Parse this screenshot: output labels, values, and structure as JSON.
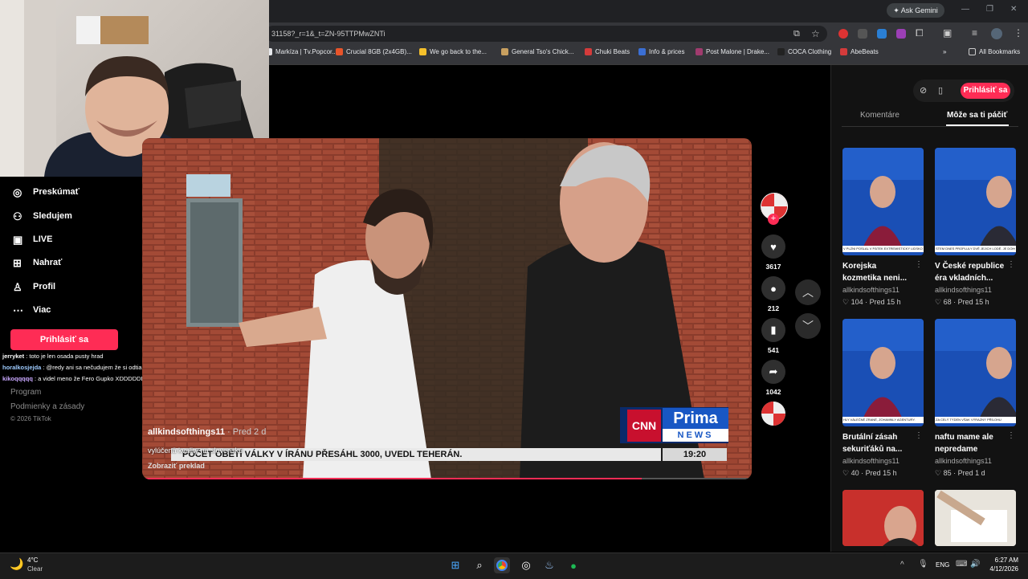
{
  "browser": {
    "gemini_label": "Ask Gemini",
    "url": "31158?_r=1&_t=ZN-95TTPMwZNTi",
    "bookmarks": [
      {
        "label": "Markíza | Tv.Popcor...",
        "color": "#e8eaed"
      },
      {
        "label": "Crucial 8GB (2x4GB)...",
        "color": "#e8542a"
      },
      {
        "label": "We go back to the...",
        "color": "#f5c02b"
      },
      {
        "label": "General Tso's Chick...",
        "color": "#c8a060"
      },
      {
        "label": "Chuki Beats",
        "color": "#d43b3b"
      },
      {
        "label": "Info & prices",
        "color": "#3b6fd4"
      },
      {
        "label": "Post Malone | Drake...",
        "color": "#a03b6e"
      },
      {
        "label": "COCA Clothing",
        "color": "#222222"
      },
      {
        "label": "AbeBeats",
        "color": "#d43b3b"
      }
    ],
    "all_bookmarks": "All Bookmarks"
  },
  "sidebar": {
    "items": [
      {
        "label": "Preskúmať",
        "icon": "compass-icon"
      },
      {
        "label": "Sledujem",
        "icon": "user-follow-icon"
      },
      {
        "label": "LIVE",
        "icon": "live-tv-icon"
      },
      {
        "label": "Nahrať",
        "icon": "upload-icon"
      },
      {
        "label": "Profil",
        "icon": "profile-icon"
      },
      {
        "label": "Viac",
        "icon": "more-icon"
      }
    ],
    "login": "Prihlásiť sa",
    "footer": [
      "Program",
      "Podmienky a zásady",
      "© 2026 TikTok"
    ]
  },
  "chat": [
    {
      "user": "jerryket",
      "text": " : toto je len osada pusty hrad"
    },
    {
      "user": "horalkosjejda",
      "text": " : @redy ani sa nečudujem že si odtiaľ odišiel a poslal tam babku"
    },
    {
      "user": "kikoqqqqq",
      "text": " : a videl meno že Fero Gupko XDDDDDDDDdd"
    }
  ],
  "video": {
    "author": "allkindsofthings11",
    "age": " · Pred 2 d",
    "caption": "vylúčenä kvality na slovensku",
    "translate": "Zobraziť preklad",
    "news_headline": "POČET OBĚTÍ VÁLKY V ÍRÁNU PŘESÁHL 3000, UVEDL TEHERÁN.",
    "news_time": "19:20",
    "cnn": "CNN",
    "prima": "Prima",
    "news": "NEWS",
    "progress": 0.82
  },
  "actions": {
    "likes": "3617",
    "comments": "212",
    "saves": "541",
    "shares": "1042"
  },
  "right_panel": {
    "login": "Prihlásiť sa",
    "tabs": [
      "Komentáre",
      "Môže sa ti páčiť"
    ],
    "cards": [
      {
        "title": "Korejska kozmetika neni...",
        "user": "allkindsofthings11",
        "likes": "104",
        "age": "Pred 15 h",
        "ticker": "V PLZNI POSLAL V PÁTEK EXTREMISTICKÝ LIDSKOHO"
      },
      {
        "title": "V České republice éra vkladních...",
        "user": "allkindsofthings11",
        "likes": "68",
        "age": "Pred 15 h",
        "ticker": "STEM DNES PROPLULY DVĚ JEJICH LODĚ. JE DOHO"
      },
      {
        "title": "Brutální zásah sekuriťáků na...",
        "user": "allkindsofthings11",
        "likes": "40",
        "age": "Pred 15 h",
        "ticker": "HLY VÁLEČNÉ ZRANÉ, ZOHAMNLY AGENTURY."
      },
      {
        "title": "naftu mame ale nepredame",
        "user": "allkindsofthings11",
        "likes": "85",
        "age": "Pred 1 d",
        "ticker": "ZA CELÝ TÝDEN VŠAK VÝRAZNÝ PŘÍLOHU"
      }
    ]
  },
  "taskbar": {
    "temp": "4°C",
    "weather": "Clear",
    "lang": "ENG",
    "time": "6:27 AM",
    "date": "4/12/2026"
  }
}
